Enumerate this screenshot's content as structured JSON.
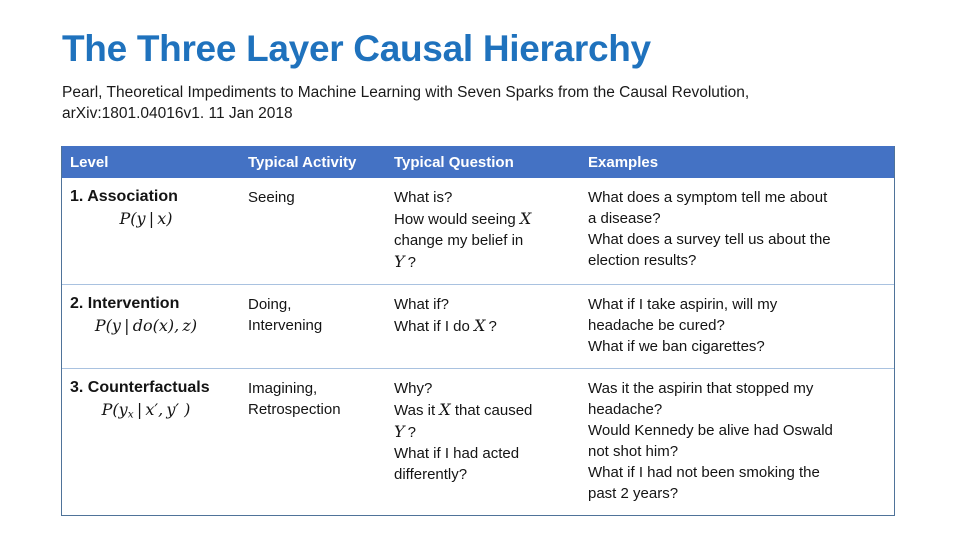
{
  "slide": {
    "title": "The Three Layer Causal Hierarchy",
    "subtitle": "Pearl, Theoretical Impediments to Machine Learning with Seven Sparks from the Causal Revolution, arXiv:1801.04016v1.  11 Jan 2018",
    "title_color": "#1f72bd",
    "header_band_color": "#4472c4",
    "border_color": "#4f7399"
  },
  "table": {
    "headers": {
      "level": "Level",
      "activity": "Typical Activity",
      "question": "Typical Question",
      "examples": "Examples"
    },
    "rows": [
      {
        "level_name": "1. Association",
        "formula_prefix": "P(y | x)",
        "activity": "Seeing",
        "question_lines": [
          "What is?",
          "How would seeing X",
          "change my belief in",
          "Y ?"
        ],
        "question_text": "What is? How would seeing X change my belief in Y ?",
        "examples_lines": [
          "What does a symptom tell me about",
          "a disease?",
          "What does a survey tell us about the",
          "election results?"
        ],
        "examples_text": "What does a symptom tell me about a disease? What does a survey tell us about the election results?"
      },
      {
        "level_name": "2. Intervention",
        "formula_prefix": "P(y | do(x), z)",
        "activity": "Doing,\nIntervening",
        "question_lines": [
          "What if?",
          "What if I do X ?"
        ],
        "question_text": "What if? What if I do X ?",
        "examples_lines": [
          "What if I take aspirin, will my",
          "headache be cured?",
          "What if we ban cigarettes?"
        ],
        "examples_text": "What if I take aspirin, will my headache be cured? What if we ban cigarettes?"
      },
      {
        "level_name": "3. Counterfactuals",
        "formula_prefix": "P(yx | x', y' )",
        "activity": "Imagining,\nRetrospection",
        "question_lines": [
          "Why?",
          "Was it X that caused",
          "Y ?",
          "What if I had acted",
          "differently?"
        ],
        "question_text": "Why? Was it X that caused Y ? What if I had acted differently?",
        "examples_lines": [
          "Was it the aspirin that stopped my",
          "headache?",
          "Would Kennedy be alive had Oswald",
          "not shot him?",
          "What if I had not been smoking the",
          "past 2 years?"
        ],
        "examples_text": "Was it the aspirin that stopped my headache? Would Kennedy be alive had Oswald not shot him? What if I had not been smoking the past 2 years?"
      }
    ]
  }
}
